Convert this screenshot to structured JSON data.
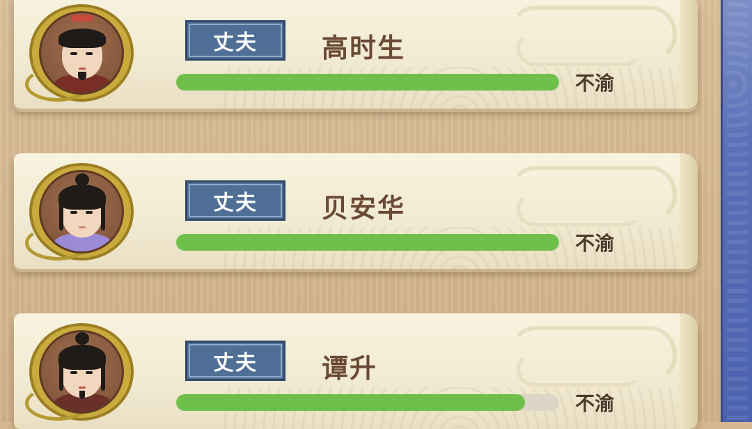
{
  "colors": {
    "bar_fill": "#6fbf4d",
    "tag_bg": "#4f6f96",
    "name_text": "#6a4a35",
    "side_panel": "#5a6fb8"
  },
  "members": [
    {
      "role": "丈夫",
      "name": "高时生",
      "status": "不渝",
      "progress": 1.0,
      "avatar_icon": "male-official-portrait-icon",
      "robe_color": "#7a2d24"
    },
    {
      "role": "丈夫",
      "name": "贝安华",
      "status": "不渝",
      "progress": 1.0,
      "avatar_icon": "male-scholar-portrait-icon",
      "robe_color": "#9b8bd6"
    },
    {
      "role": "丈夫",
      "name": "谭升",
      "status": "不渝",
      "progress": 0.91,
      "avatar_icon": "male-swordsman-portrait-icon",
      "robe_color": "#6a2f28"
    }
  ]
}
